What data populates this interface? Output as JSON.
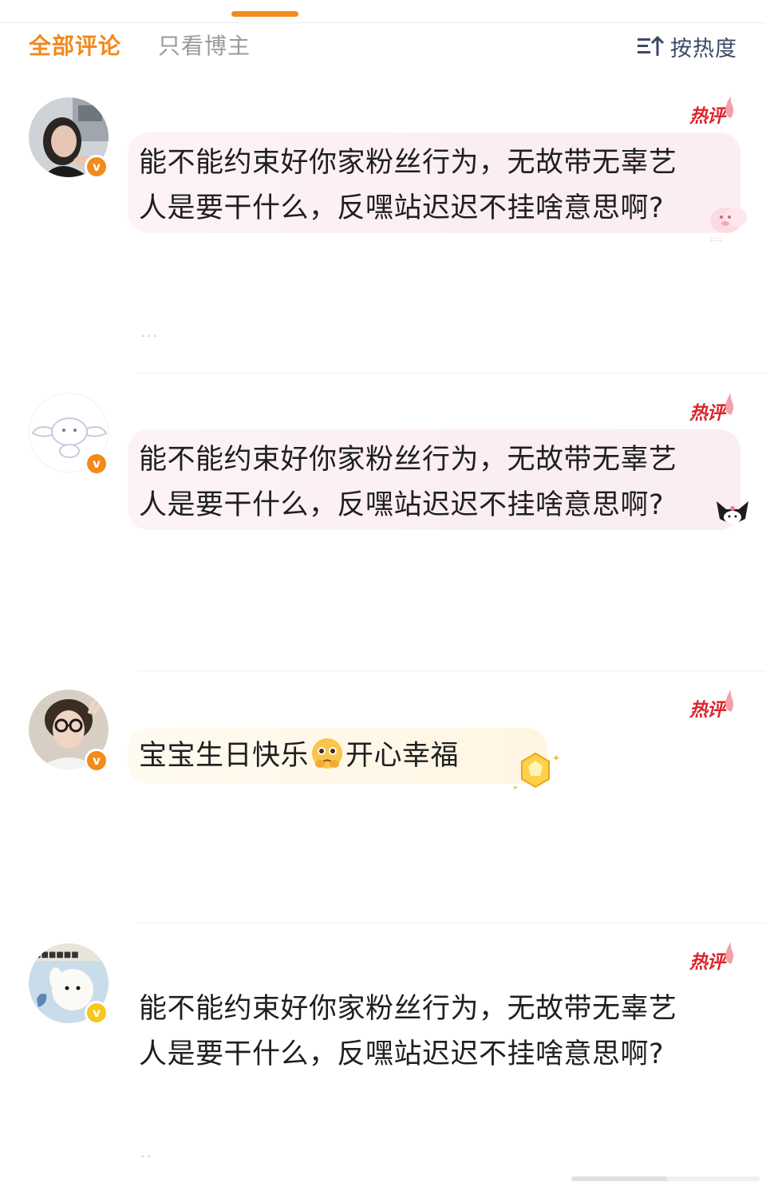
{
  "tabs": {
    "all_comments": "全部评论",
    "blogger_only": "只看博主",
    "sort_label": "按热度"
  },
  "hot_tag_label": "热评",
  "comments": [
    {
      "text_line1": "能不能约束好你家粉丝行为，无故带无辜艺",
      "text_line2": "人是要干什么，反嘿站迟迟不挂啥意思啊?",
      "more": "..."
    },
    {
      "text_line1": "能不能约束好你家粉丝行为，无故带无辜艺",
      "text_line2": "人是要干什么，反嘿站迟迟不挂啥意思啊?"
    },
    {
      "text_before_emoji": "宝宝生日快乐",
      "emoji": "pleading-face-emoji",
      "text_after_emoji": "开心幸福"
    },
    {
      "text_line1": "能不能约束好你家粉丝行为，无故带无辜艺",
      "text_line2": "人是要干什么，反嘿站迟迟不挂啥意思啊?",
      "more": ".."
    }
  ],
  "colors": {
    "accent": "#f28b1b",
    "hot_tag": "#d9262d",
    "tab_inactive": "#9a9a9a",
    "text": "#1f1f1f"
  },
  "icons": [
    "sort-icon",
    "verified-badge-icon",
    "hot-flame-icon",
    "pleading-face-emoji",
    "crown-badge-icon",
    "kuromi-sticker-icon",
    "pig-sticker-icon"
  ]
}
